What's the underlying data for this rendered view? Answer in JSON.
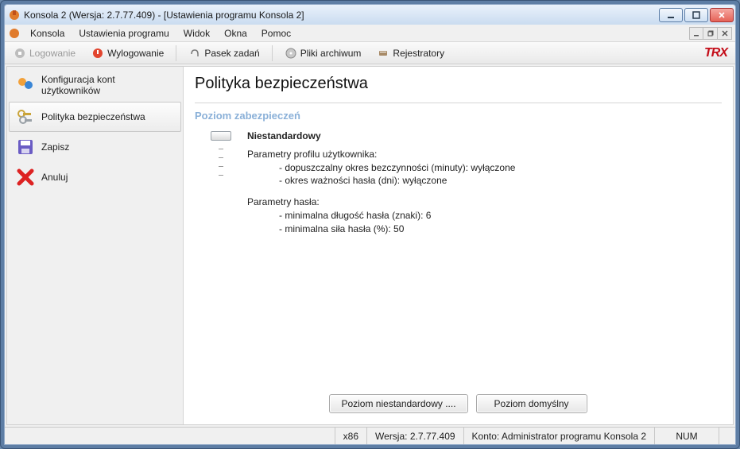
{
  "window": {
    "title": "Konsola 2 (Wersja:  2.7.77.409) - [Ustawienia programu Konsola 2]"
  },
  "menu": {
    "items": [
      "Konsola",
      "Ustawienia programu",
      "Widok",
      "Okna",
      "Pomoc"
    ]
  },
  "toolbar": {
    "login": "Logowanie",
    "logout": "Wylogowanie",
    "taskbar": "Pasek zadań",
    "archive": "Pliki archiwum",
    "recorders": "Rejestratory",
    "logo": "TRX"
  },
  "sidebar": {
    "items": [
      {
        "label": "Konfiguracja kont użytkowników"
      },
      {
        "label": "Polityka bezpieczeństwa"
      },
      {
        "label": "Zapisz"
      },
      {
        "label": "Anuluj"
      }
    ]
  },
  "main": {
    "title": "Polityka bezpieczeństwa",
    "section": "Poziom zabezpieczeń",
    "level_name": "Niestandardowy",
    "profile_heading": "Parametry profilu użytkownika:",
    "profile_idle": "- dopuszczalny okres bezczynności (minuty): wyłączone",
    "profile_expiry": "- okres ważności hasła (dni): wyłączone",
    "password_heading": "Parametry hasła:",
    "password_minlen": "- minimalna długość hasła (znaki): 6",
    "password_strength": "- minimalna siła hasła (%): 50",
    "btn_custom": "Poziom niestandardowy ....",
    "btn_default": "Poziom domyślny"
  },
  "status": {
    "arch": "x86",
    "version": "Wersja: 2.7.77.409",
    "account": "Konto: Administrator programu Konsola 2",
    "num": "NUM"
  }
}
